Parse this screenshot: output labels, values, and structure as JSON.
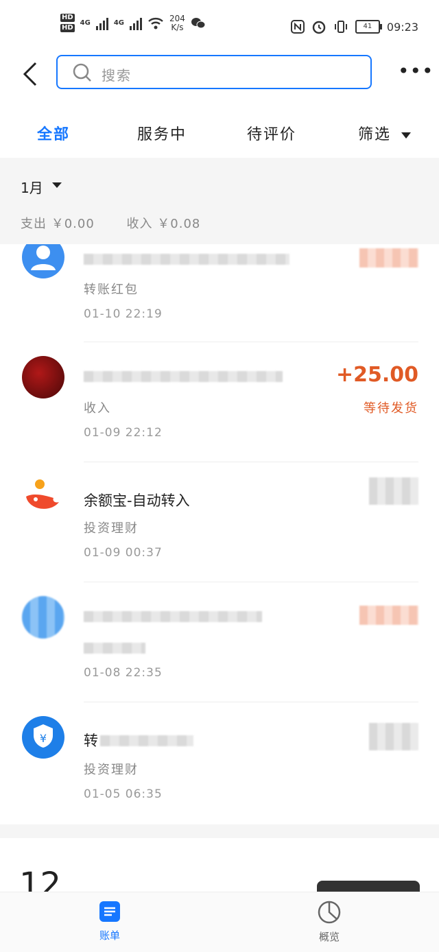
{
  "status_bar": {
    "network": "4G",
    "speed_value": "204",
    "speed_unit": "K/s",
    "battery": "41",
    "time": "09:23"
  },
  "header": {
    "search_placeholder": "搜索",
    "more": "•••"
  },
  "tabs": [
    {
      "label": "全部",
      "active": true
    },
    {
      "label": "服务中",
      "active": false
    },
    {
      "label": "待评价",
      "active": false
    },
    {
      "label": "筛选",
      "active": false
    }
  ],
  "month": {
    "label": "1月",
    "expense": "支出 ￥0.00",
    "income": "收入 ￥0.08"
  },
  "transactions": [
    {
      "title": "",
      "category": "转账红包",
      "time": "01-10  22:19",
      "amount": "",
      "status": ""
    },
    {
      "title": "",
      "category": "收入",
      "time": "01-09  22:12",
      "amount": "+25.00",
      "status": "等待发货"
    },
    {
      "title": "余额宝-自动转入",
      "category": "投资理财",
      "time": "01-09  00:37",
      "amount": "",
      "status": ""
    },
    {
      "title": "",
      "category": "",
      "time": "01-08  22:35",
      "amount": "",
      "status": ""
    },
    {
      "title": "转",
      "category": "投资理财",
      "time": "01-05  06:35",
      "amount": "",
      "status": ""
    }
  ],
  "next_month": {
    "label": "12"
  },
  "bottom_nav": [
    {
      "label": "账单",
      "icon": "bill-icon",
      "active": true
    },
    {
      "label": "概览",
      "icon": "pie-chart-icon",
      "active": false
    }
  ],
  "colors": {
    "accent": "#1677ff",
    "amount": "#e05a25"
  }
}
